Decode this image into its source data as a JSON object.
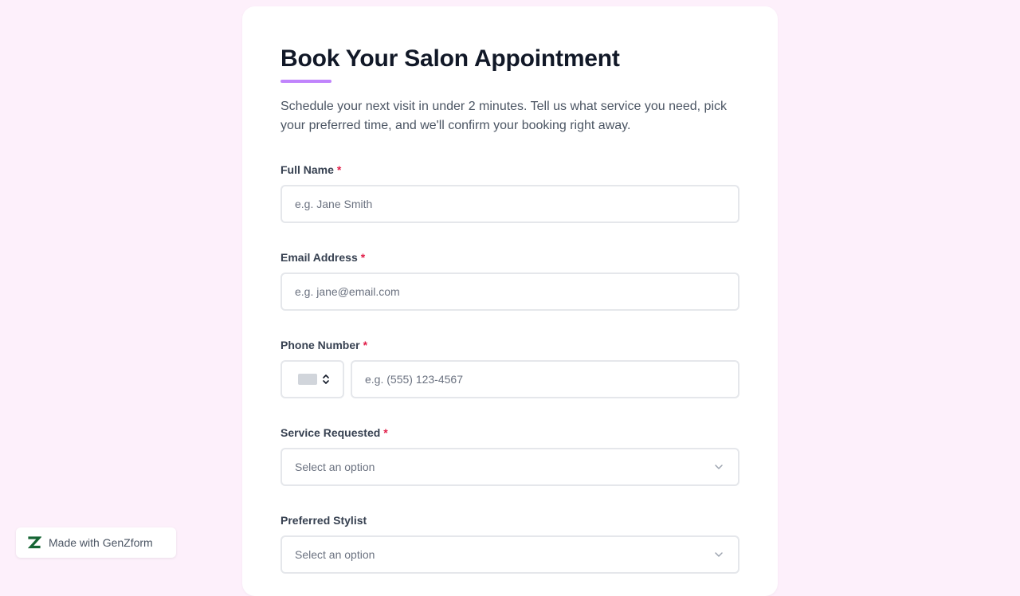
{
  "form": {
    "title": "Book Your Salon Appointment",
    "description": "Schedule your next visit in under 2 minutes. Tell us what service you need, pick your preferred time, and we'll confirm your booking right away.",
    "accent_color": "#c084fc",
    "required_marker": "*",
    "fields": {
      "full_name": {
        "label": "Full Name",
        "placeholder": "e.g. Jane Smith",
        "required": true
      },
      "email": {
        "label": "Email Address",
        "placeholder": "e.g. jane@email.com",
        "required": true
      },
      "phone": {
        "label": "Phone Number",
        "placeholder": "e.g. (555) 123-4567",
        "required": true,
        "country_icon": "flag-icon"
      },
      "service": {
        "label": "Service Requested",
        "placeholder": "Select an option",
        "required": true
      },
      "stylist": {
        "label": "Preferred Stylist",
        "placeholder": "Select an option",
        "required": false
      }
    }
  },
  "branding": {
    "badge_text": "Made with GenZform",
    "logo_icon": "genzform-logo-icon",
    "logo_color": "#166534"
  }
}
